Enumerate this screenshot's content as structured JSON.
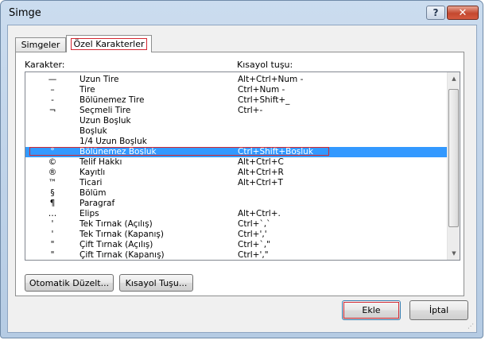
{
  "window": {
    "title": "Simge"
  },
  "titlebar": {
    "help_glyph": "?",
    "close_glyph": "✕"
  },
  "tabs": [
    {
      "label": "Simgeler"
    },
    {
      "label": "Özel Karakterler"
    }
  ],
  "columns": {
    "character": "Karakter:",
    "shortcut": "Kısayol tuşu:"
  },
  "rows": [
    {
      "sym": "—",
      "name": "Uzun Tire",
      "key": "Alt+Ctrl+Num -"
    },
    {
      "sym": "–",
      "name": "Tire",
      "key": "Ctrl+Num -"
    },
    {
      "sym": "-",
      "name": "Bölünemez Tire",
      "key": "Ctrl+Shift+_"
    },
    {
      "sym": "¬",
      "name": "Seçmeli Tire",
      "key": "Ctrl+-"
    },
    {
      "sym": "",
      "name": "Uzun Boşluk",
      "key": ""
    },
    {
      "sym": "",
      "name": "Boşluk",
      "key": ""
    },
    {
      "sym": "",
      "name": "1/4 Uzun Boşluk",
      "key": ""
    },
    {
      "sym": "°",
      "name": "Bölünemez Boşluk",
      "key": "Ctrl+Shift+Boşluk",
      "selected": true
    },
    {
      "sym": "©",
      "name": "Telif Hakkı",
      "key": "Alt+Ctrl+C"
    },
    {
      "sym": "®",
      "name": "Kayıtlı",
      "key": "Alt+Ctrl+R"
    },
    {
      "sym": "™",
      "name": "Ticari",
      "key": "Alt+Ctrl+T"
    },
    {
      "sym": "§",
      "name": "Bölüm",
      "key": ""
    },
    {
      "sym": "¶",
      "name": "Paragraf",
      "key": ""
    },
    {
      "sym": "…",
      "name": "Elips",
      "key": "Alt+Ctrl+."
    },
    {
      "sym": "'",
      "name": "Tek Tırnak (Açılış)",
      "key": "Ctrl+`,`"
    },
    {
      "sym": "'",
      "name": "Tek Tırnak (Kapanış)",
      "key": "Ctrl+','"
    },
    {
      "sym": "\"",
      "name": "Çift Tırnak (Açılış)",
      "key": "Ctrl+`,\""
    },
    {
      "sym": "\"",
      "name": "Çift Tırnak (Kapanış)",
      "key": "Ctrl+',\""
    }
  ],
  "buttons": {
    "autocorrect": "Otomatik Düzelt...",
    "shortcut": "Kısayol Tuşu...",
    "insert": "Ekle",
    "cancel": "İptal"
  },
  "scrollbar": {
    "up_glyph": "▲",
    "down_glyph": "▼"
  },
  "colors": {
    "selection": "#3399ff",
    "highlight_outline": "#d42832"
  }
}
